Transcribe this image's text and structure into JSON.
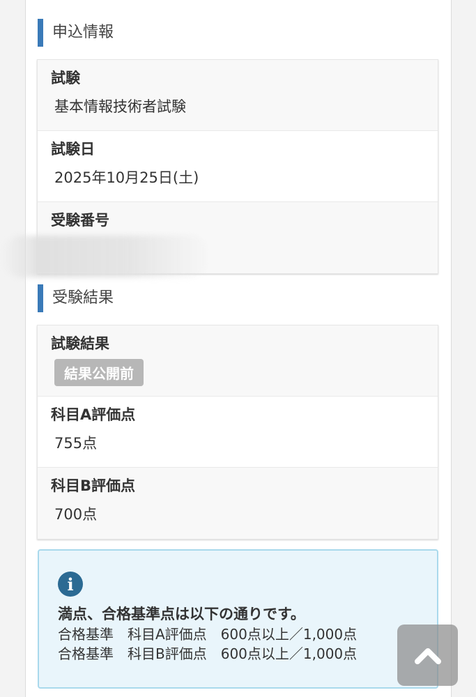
{
  "application": {
    "title": "申込情報",
    "rows": [
      {
        "label": "試験",
        "value": "基本情報技術者試験"
      },
      {
        "label": "試験日",
        "value": "2025年10月25日(土)"
      },
      {
        "label": "受験番号",
        "value": ""
      }
    ]
  },
  "result": {
    "title": "受験結果",
    "rows": [
      {
        "label": "試験結果",
        "badge": "結果公開前"
      },
      {
        "label": "科目A評価点",
        "value": "755点"
      },
      {
        "label": "科目B評価点",
        "value": "700点"
      }
    ]
  },
  "notice": {
    "icon": "info-icon",
    "heading": "満点、合格基準点は以下の通りです。",
    "lines": [
      "合格基準　科目A評価点　600点以上／1,000点",
      "合格基準　科目B評価点　600点以上／1,000点"
    ]
  },
  "scroll_top": {
    "icon": "chevron-up-icon"
  },
  "colors": {
    "accent": "#3a7ab8",
    "badge_bg": "#b7b7b7",
    "info_bg": "#e9f5fb",
    "info_border": "#a9d9ec",
    "info_icon": "#2b6a93"
  }
}
